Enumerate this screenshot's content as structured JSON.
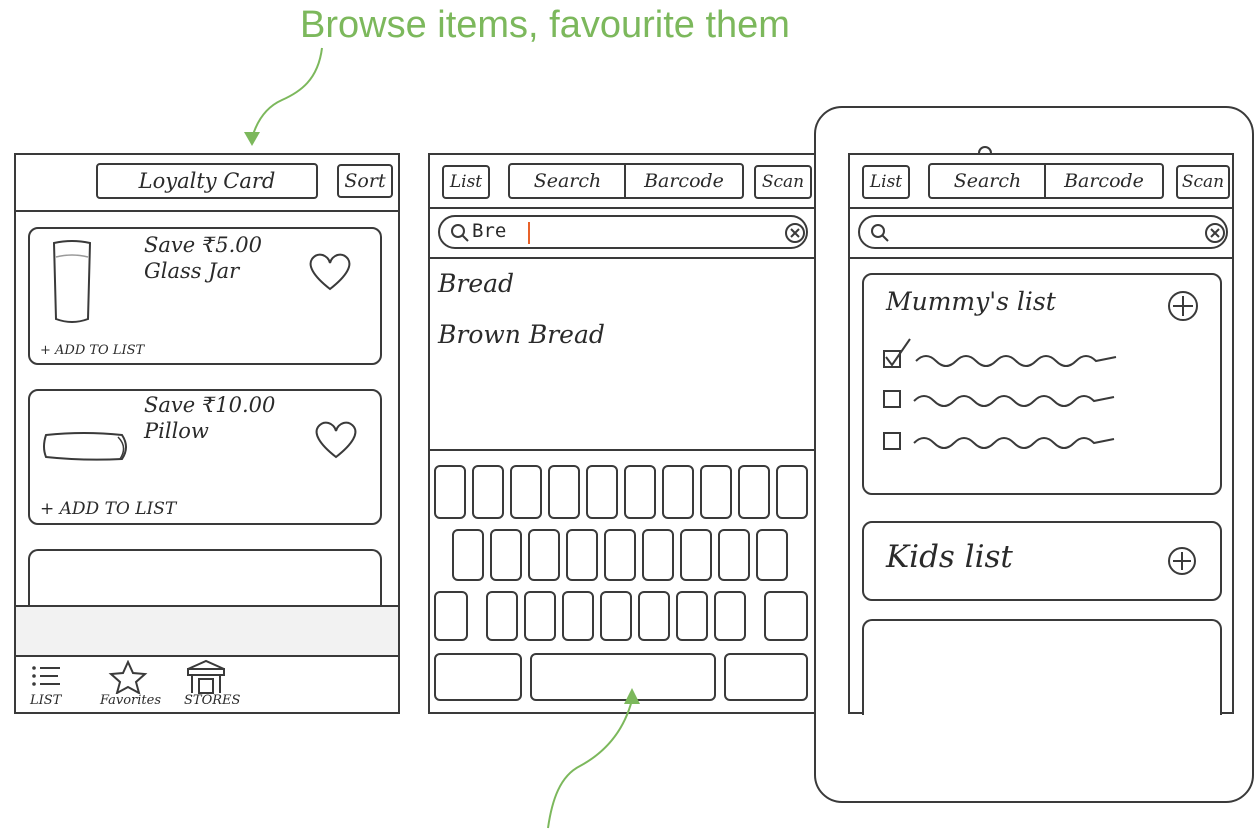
{
  "annotations": {
    "top": "Browse items, favourite them",
    "color": "#7cb85c"
  },
  "screen1": {
    "loyalty_label": "Loyalty Card",
    "sort_label": "Sort",
    "items": [
      {
        "offer": "Save ₹5.00",
        "name": "Glass Jar",
        "add": "+ ADD TO LIST"
      },
      {
        "offer": "Save ₹10.00",
        "name": "Pillow",
        "add": "+ ADD TO LIST"
      }
    ],
    "nav": [
      {
        "label": "LIST",
        "icon": "list-icon"
      },
      {
        "label": "Favorites",
        "icon": "star-icon"
      },
      {
        "label": "STORES",
        "icon": "store-icon"
      }
    ]
  },
  "screen2": {
    "list_label": "List",
    "search_label": "Search",
    "barcode_label": "Barcode",
    "scan_label": "Scan",
    "search_value": "Bre",
    "results": [
      "Bread",
      "Brown Bread"
    ]
  },
  "screen3": {
    "list_label": "List",
    "search_label": "Search",
    "barcode_label": "Barcode",
    "scan_label": "Scan",
    "lists": [
      {
        "title": "Mummy's list"
      },
      {
        "title": "Kids list"
      }
    ]
  }
}
